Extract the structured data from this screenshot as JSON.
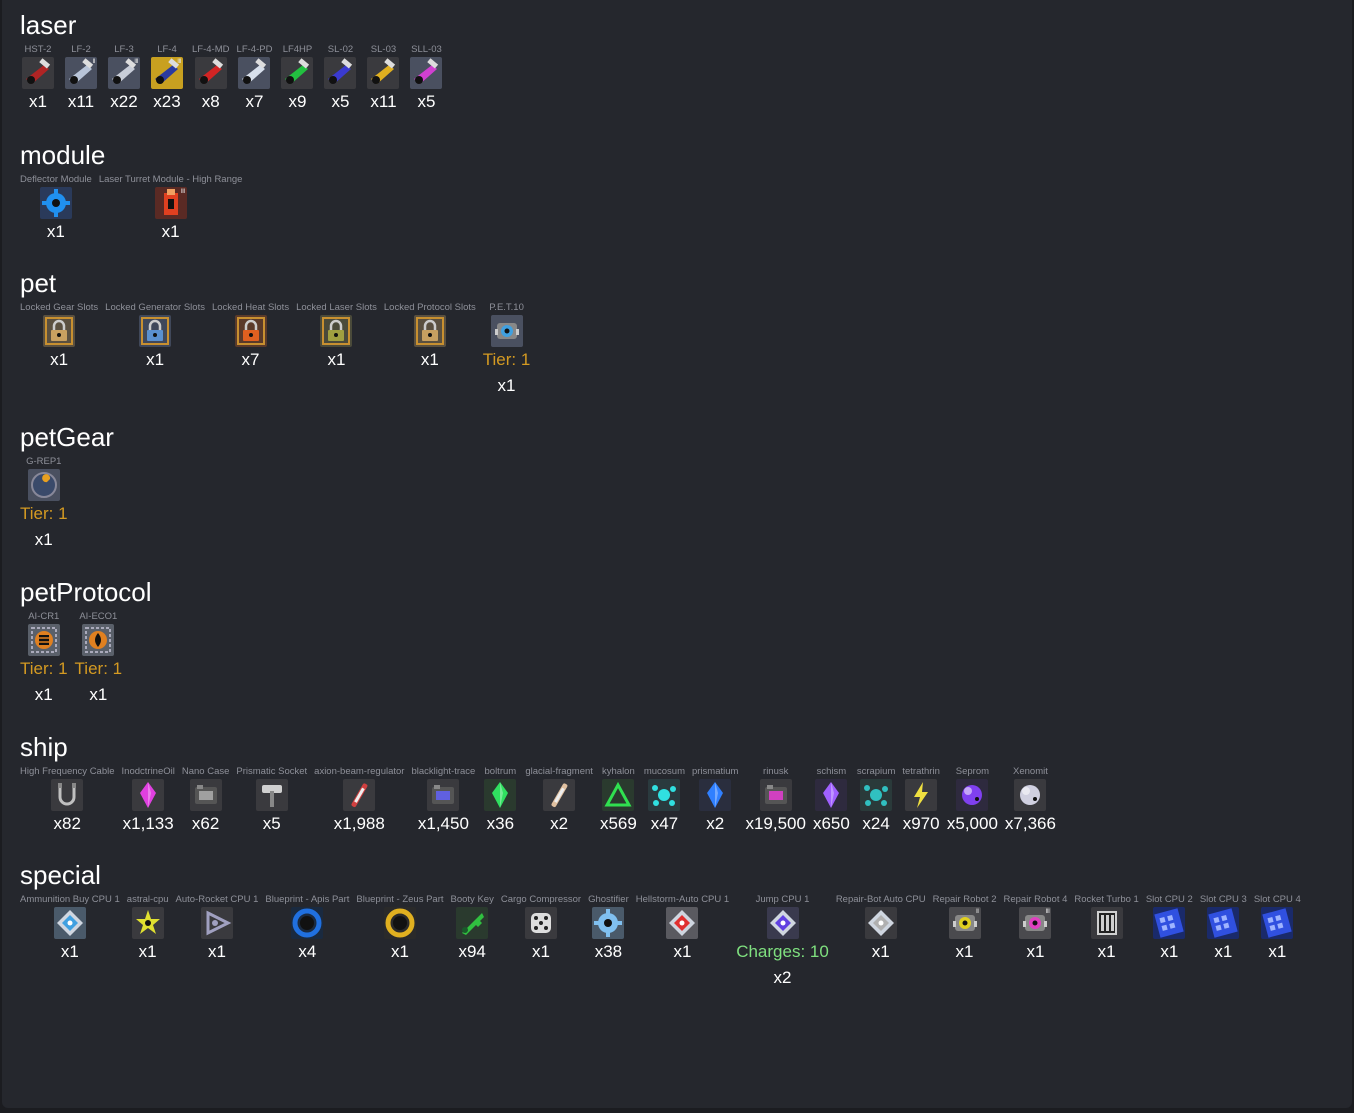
{
  "categories": [
    {
      "title": "laser",
      "items": [
        {
          "name": "HST-2",
          "qty": "x1",
          "color": "#b02424",
          "bg": "#3a3a3e",
          "icon": "laser-cannon-icon",
          "shape": "cannon"
        },
        {
          "name": "LF-2",
          "qty": "x11",
          "color": "#b8c4d8",
          "bg": "#4a5060",
          "icon": "laser-cannon-icon",
          "shape": "cannon",
          "rank": "II"
        },
        {
          "name": "LF-3",
          "qty": "x22",
          "color": "#c8cdd8",
          "bg": "#4a5060",
          "icon": "laser-cannon-icon",
          "shape": "cannon",
          "rank": "III"
        },
        {
          "name": "LF-4",
          "qty": "x23",
          "color": "#2a3aa0",
          "bg": "#c8a020",
          "icon": "laser-cannon-icon",
          "shape": "cannon",
          "rank": "III"
        },
        {
          "name": "LF-4-MD",
          "qty": "x8",
          "color": "#d22424",
          "bg": "#3a3a3e",
          "icon": "laser-cannon-icon",
          "shape": "cannon"
        },
        {
          "name": "LF-4-PD",
          "qty": "x7",
          "color": "#d8e0ec",
          "bg": "#4a5060",
          "icon": "laser-cannon-icon",
          "shape": "cannon"
        },
        {
          "name": "LF4HP",
          "qty": "x9",
          "color": "#22c040",
          "bg": "#3a3a3e",
          "icon": "laser-cannon-icon",
          "shape": "cannon"
        },
        {
          "name": "SL-02",
          "qty": "x5",
          "color": "#3a3ad0",
          "bg": "#3a3a3e",
          "icon": "laser-cannon-icon",
          "shape": "cannon"
        },
        {
          "name": "SL-03",
          "qty": "x11",
          "color": "#e0b020",
          "bg": "#3a3a3e",
          "icon": "laser-cannon-icon",
          "shape": "cannon"
        },
        {
          "name": "SLL-03",
          "qty": "x5",
          "color": "#d040d0",
          "bg": "#4a5060",
          "icon": "laser-cannon-icon",
          "shape": "cannon"
        }
      ]
    },
    {
      "title": "module",
      "items": [
        {
          "name": "Deflector Module",
          "qty": "x1",
          "color": "#2090f0",
          "bg": "#2a3a5a",
          "icon": "deflector-module-icon",
          "shape": "gear"
        },
        {
          "name": "Laser Turret Module - High Range",
          "qty": "x1",
          "color": "#e04020",
          "bg": "#5a2a24",
          "icon": "laser-turret-module-icon",
          "shape": "tower",
          "rank": "III"
        }
      ]
    },
    {
      "title": "pet",
      "items": [
        {
          "name": "Locked Gear Slots",
          "qty": "x1",
          "color": "#c8a060",
          "bg": "#5a5040",
          "icon": "padlock-icon",
          "shape": "lock"
        },
        {
          "name": "Locked Generator Slots",
          "qty": "x1",
          "color": "#5a90d0",
          "bg": "#40485a",
          "icon": "padlock-icon",
          "shape": "lock"
        },
        {
          "name": "Locked Heat Slots",
          "qty": "x7",
          "color": "#e06020",
          "bg": "#5a3a2a",
          "icon": "padlock-icon",
          "shape": "lock"
        },
        {
          "name": "Locked Laser Slots",
          "qty": "x1",
          "color": "#a0a040",
          "bg": "#4a4a3a",
          "icon": "padlock-icon",
          "shape": "lock"
        },
        {
          "name": "Locked Protocol Slots",
          "qty": "x1",
          "color": "#c8a060",
          "bg": "#5a5040",
          "icon": "padlock-icon",
          "shape": "lock"
        },
        {
          "name": "P.E.T.10",
          "qty": "x1",
          "tier": "Tier: 1",
          "color": "#40a0e0",
          "bg": "#4a5060",
          "icon": "pet-robot-icon",
          "shape": "robot"
        }
      ]
    },
    {
      "title": "petGear",
      "items": [
        {
          "name": "G-REP1",
          "qty": "x1",
          "tier": "Tier: 1",
          "color": "#e8a020",
          "bg": "#4a5060",
          "icon": "repair-wrench-icon",
          "shape": "wrench"
        }
      ]
    },
    {
      "title": "petProtocol",
      "items": [
        {
          "name": "AI-CR1",
          "qty": "x1",
          "tier": "Tier: 1",
          "color": "#e08020",
          "bg": "#5a606a",
          "icon": "protocol-chip-icon",
          "shape": "chip"
        },
        {
          "name": "AI-ECO1",
          "qty": "x1",
          "tier": "Tier: 1",
          "color": "#e08020",
          "bg": "#5a606a",
          "icon": "protocol-flame-icon",
          "shape": "flame"
        }
      ]
    },
    {
      "title": "ship",
      "items": [
        {
          "name": "High Frequency Cable",
          "qty": "x82",
          "color": "#c0c0c0",
          "bg": "#3a3a3e",
          "icon": "cable-icon",
          "shape": "cable"
        },
        {
          "name": "InodctrineOil",
          "qty": "x1,133",
          "color": "#e040e0",
          "bg": "#3a3a3e",
          "icon": "oil-crystal-icon",
          "shape": "crystal"
        },
        {
          "name": "Nano Case",
          "qty": "x62",
          "color": "#a0a0a0",
          "bg": "#3a3a3e",
          "icon": "nano-case-icon",
          "shape": "box"
        },
        {
          "name": "Prismatic Socket",
          "qty": "x5",
          "color": "#d0d0d0",
          "bg": "#3a3a3e",
          "icon": "socket-icon",
          "shape": "hammer"
        },
        {
          "name": "axion-beam-regulator",
          "qty": "x1,988",
          "color": "#d04040",
          "bg": "#3a3a3e",
          "icon": "beam-regulator-icon",
          "shape": "rod"
        },
        {
          "name": "blacklight-trace",
          "qty": "x1,450",
          "color": "#6060e0",
          "bg": "#3a3a3e",
          "icon": "blacklight-trace-icon",
          "shape": "box"
        },
        {
          "name": "boltrum",
          "qty": "x36",
          "color": "#30e060",
          "bg": "#2a3a2e",
          "icon": "boltrum-crystal-icon",
          "shape": "crystal"
        },
        {
          "name": "glacial-fragment",
          "qty": "x2",
          "color": "#e0c0a0",
          "bg": "#3a3a3e",
          "icon": "glacial-fragment-icon",
          "shape": "rod"
        },
        {
          "name": "kyhalon",
          "qty": "x569",
          "color": "#30e050",
          "bg": "#2a3a2e",
          "icon": "kyhalon-triangle-icon",
          "shape": "triangle"
        },
        {
          "name": "mucosum",
          "qty": "x47",
          "color": "#30e0e0",
          "bg": "#2a3a3e",
          "icon": "mucosum-icon",
          "shape": "splash"
        },
        {
          "name": "prismatium",
          "qty": "x2",
          "color": "#3080ff",
          "bg": "#2a2e3e",
          "icon": "prismatium-crystal-icon",
          "shape": "crystal"
        },
        {
          "name": "rinusk",
          "qty": "x19,500",
          "color": "#d040c0",
          "bg": "#3a3a3e",
          "icon": "rinusk-icon",
          "shape": "box"
        },
        {
          "name": "schism",
          "qty": "x650",
          "color": "#a060ff",
          "bg": "#2e2a3e",
          "icon": "schism-crystal-icon",
          "shape": "crystal"
        },
        {
          "name": "scrapium",
          "qty": "x24",
          "color": "#30c0c0",
          "bg": "#2a3a3a",
          "icon": "scrapium-icon",
          "shape": "splash"
        },
        {
          "name": "tetrathrin",
          "qty": "x970",
          "color": "#f0e040",
          "bg": "#3a3a3e",
          "icon": "tetrathrin-bolt-icon",
          "shape": "bolt"
        },
        {
          "name": "Seprom",
          "qty": "x5,000",
          "color": "#8040f0",
          "bg": "#2e2a3e",
          "icon": "seprom-orb-icon",
          "shape": "orb"
        },
        {
          "name": "Xenomit",
          "qty": "x7,366",
          "color": "#d0d0e0",
          "bg": "#3a3a3e",
          "icon": "xenomit-icon",
          "shape": "orb"
        }
      ]
    },
    {
      "title": "special",
      "items": [
        {
          "name": "Ammunition Buy CPU 1",
          "qty": "x1",
          "color": "#40a0e0",
          "bg": "#4a5a6a",
          "icon": "clock-cpu-icon",
          "shape": "diamond"
        },
        {
          "name": "astral-cpu",
          "qty": "x1",
          "color": "#e0e030",
          "bg": "#3a3a3e",
          "icon": "astral-cpu-icon",
          "shape": "star"
        },
        {
          "name": "Auto-Rocket CPU 1",
          "qty": "x1",
          "color": "#a0a0c0",
          "bg": "#3a3a3e",
          "icon": "rocket-cpu-icon",
          "shape": "tri-outline"
        },
        {
          "name": "Blueprint - Apis Part",
          "qty": "x4",
          "color": "#2070e0",
          "bg": "#1a2a40",
          "icon": "blueprint-ring-icon",
          "shape": "ring"
        },
        {
          "name": "Blueprint - Zeus Part",
          "qty": "x1",
          "color": "#e0b020",
          "bg": "#2a2a2a",
          "icon": "blueprint-ring-icon",
          "shape": "ring"
        },
        {
          "name": "Booty Key",
          "qty": "x94",
          "color": "#30c040",
          "bg": "#2a3a2e",
          "icon": "booty-key-icon",
          "shape": "key"
        },
        {
          "name": "Cargo Compressor",
          "qty": "x1",
          "color": "#c0c0c0",
          "bg": "#3a3a3e",
          "icon": "compressor-icon",
          "shape": "dice"
        },
        {
          "name": "Ghostifier",
          "qty": "x38",
          "color": "#80c0f0",
          "bg": "#4a5a6a",
          "icon": "ghostifier-icon",
          "shape": "gear"
        },
        {
          "name": "Hellstorm-Auto CPU 1",
          "qty": "x1",
          "color": "#e03030",
          "bg": "#5a5a60",
          "icon": "hellstorm-cpu-icon",
          "shape": "diamond"
        },
        {
          "name": "Jump CPU 1",
          "qty": "x2",
          "charges": "Charges: 10",
          "color": "#6040e0",
          "bg": "#3a3a4e",
          "icon": "jump-cpu-icon",
          "shape": "diamond"
        },
        {
          "name": "Repair-Bot Auto CPU",
          "qty": "x1",
          "color": "#b0b0b0",
          "bg": "#3a3a3e",
          "icon": "repair-bot-cpu-icon",
          "shape": "diamond"
        },
        {
          "name": "Repair Robot 2",
          "qty": "x1",
          "color": "#e0d020",
          "bg": "#4a4a4e",
          "icon": "repair-robot-icon",
          "shape": "robot",
          "rank": "II"
        },
        {
          "name": "Repair Robot 4",
          "qty": "x1",
          "color": "#e040c0",
          "bg": "#4a4a4e",
          "icon": "repair-robot-icon",
          "shape": "robot",
          "rank": "III"
        },
        {
          "name": "Rocket Turbo 1",
          "qty": "x1",
          "color": "#d0d0d0",
          "bg": "#3a3a3e",
          "icon": "rocket-turbo-icon",
          "shape": "turbo"
        },
        {
          "name": "Slot CPU 2",
          "qty": "x1",
          "color": "#3050e0",
          "bg": "#1a2a6a",
          "icon": "slot-cpu-icon",
          "shape": "slots"
        },
        {
          "name": "Slot CPU 3",
          "qty": "x1",
          "color": "#3050e0",
          "bg": "#1a2a6a",
          "icon": "slot-cpu-icon",
          "shape": "slots"
        },
        {
          "name": "Slot CPU 4",
          "qty": "x1",
          "color": "#3050e0",
          "bg": "#1a2a6a",
          "icon": "slot-cpu-icon",
          "shape": "slots"
        }
      ]
    }
  ]
}
